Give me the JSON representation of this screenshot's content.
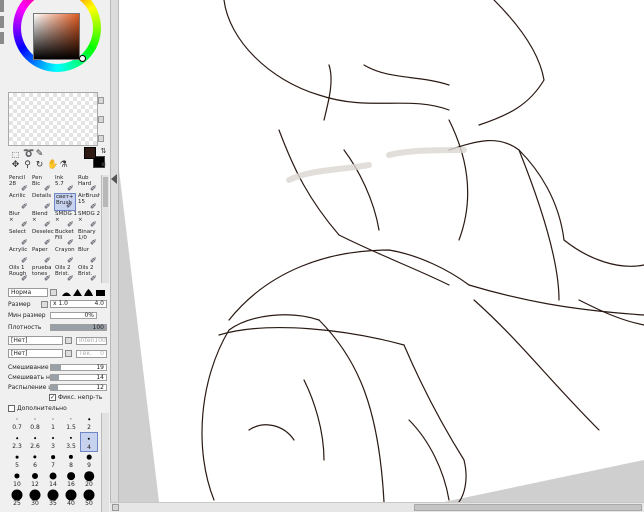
{
  "colors": {
    "primary": "#2e1a12",
    "secondary": "#000000",
    "selection": "#c7d3ee"
  },
  "brushes": [
    {
      "label": "Pencil\n28",
      "icon": "pencil-icon"
    },
    {
      "label": "Pen\nBic",
      "icon": "pen-icon"
    },
    {
      "label": "Ink\n5.7",
      "icon": "ink-icon"
    },
    {
      "label": "Rub\nHard",
      "icon": "eraser-icon"
    },
    {
      "label": "Acrilic",
      "icon": "acrylic-brush-icon"
    },
    {
      "label": "Details",
      "icon": "details-brush-icon"
    },
    {
      "label": "свет+\nBrush",
      "icon": "light-brush-icon",
      "selected": true
    },
    {
      "label": "AirBrush\n15",
      "icon": "airbrush-icon"
    },
    {
      "label": "Blur\n×",
      "icon": "blur-icon"
    },
    {
      "label": "Blend\n×",
      "icon": "blend-icon"
    },
    {
      "label": "SMDG 1\n×",
      "icon": "smudge-icon"
    },
    {
      "label": "SMDG 2\n×",
      "icon": "smudge-icon"
    },
    {
      "label": "Select",
      "icon": "select-icon"
    },
    {
      "label": "Deselect",
      "icon": "deselect-icon"
    },
    {
      "label": "Bucket\nFill",
      "icon": "bucket-icon"
    },
    {
      "label": "Binary\n1/0",
      "icon": "binary-icon"
    },
    {
      "label": "Acrylic",
      "icon": "acrylic-icon"
    },
    {
      "label": "Paper",
      "icon": "paper-icon"
    },
    {
      "label": "Crayon",
      "icon": "crayon-icon"
    },
    {
      "label": "Blur",
      "icon": "blur-icon"
    },
    {
      "label": "Oils 1\nRough",
      "icon": "oil-icon"
    },
    {
      "label": "prueba\ntones",
      "icon": "tone-icon"
    },
    {
      "label": "Oils 2\nBrist.",
      "icon": "oil-icon"
    },
    {
      "label": "Oils 2\nBrist.",
      "icon": "oil-icon"
    }
  ],
  "settings": {
    "blend_mode": "Норма",
    "size_label": "Размер",
    "size_multiplier": "x 1.0",
    "size_value": "4.0",
    "min_size_label": "Мин размер",
    "min_size_value": "0%",
    "density_label": "Плотность",
    "density_value": "100",
    "texture_1": "[Нет]",
    "texture_1_value": "Inten100",
    "texture_2": "[Нет]",
    "texture_2_label": "Тек.",
    "texture_2_value": "0",
    "blending_label": "Смешивание цвет",
    "blending_value": "19",
    "dilution_label": "Смешивать непр",
    "dilution_value": "14",
    "persistence_label": "Распыление цвет",
    "persistence_value": "12",
    "keep_opacity_label": "Фикс. непр-ть",
    "advanced_label": "Дополнительно",
    "density_fraction": 1.0,
    "blending_fraction": 0.19,
    "dilution_fraction": 0.14,
    "persistence_fraction": 0.12
  },
  "brush_sizes": [
    "0.7",
    "0.8",
    "1",
    "1.5",
    "2",
    "2.3",
    "2.6",
    "3",
    "3.5",
    "4",
    "5",
    "6",
    "7",
    "8",
    "9",
    "10",
    "12",
    "14",
    "16",
    "20",
    "25",
    "30",
    "35",
    "40",
    "50"
  ],
  "selected_size": "4"
}
